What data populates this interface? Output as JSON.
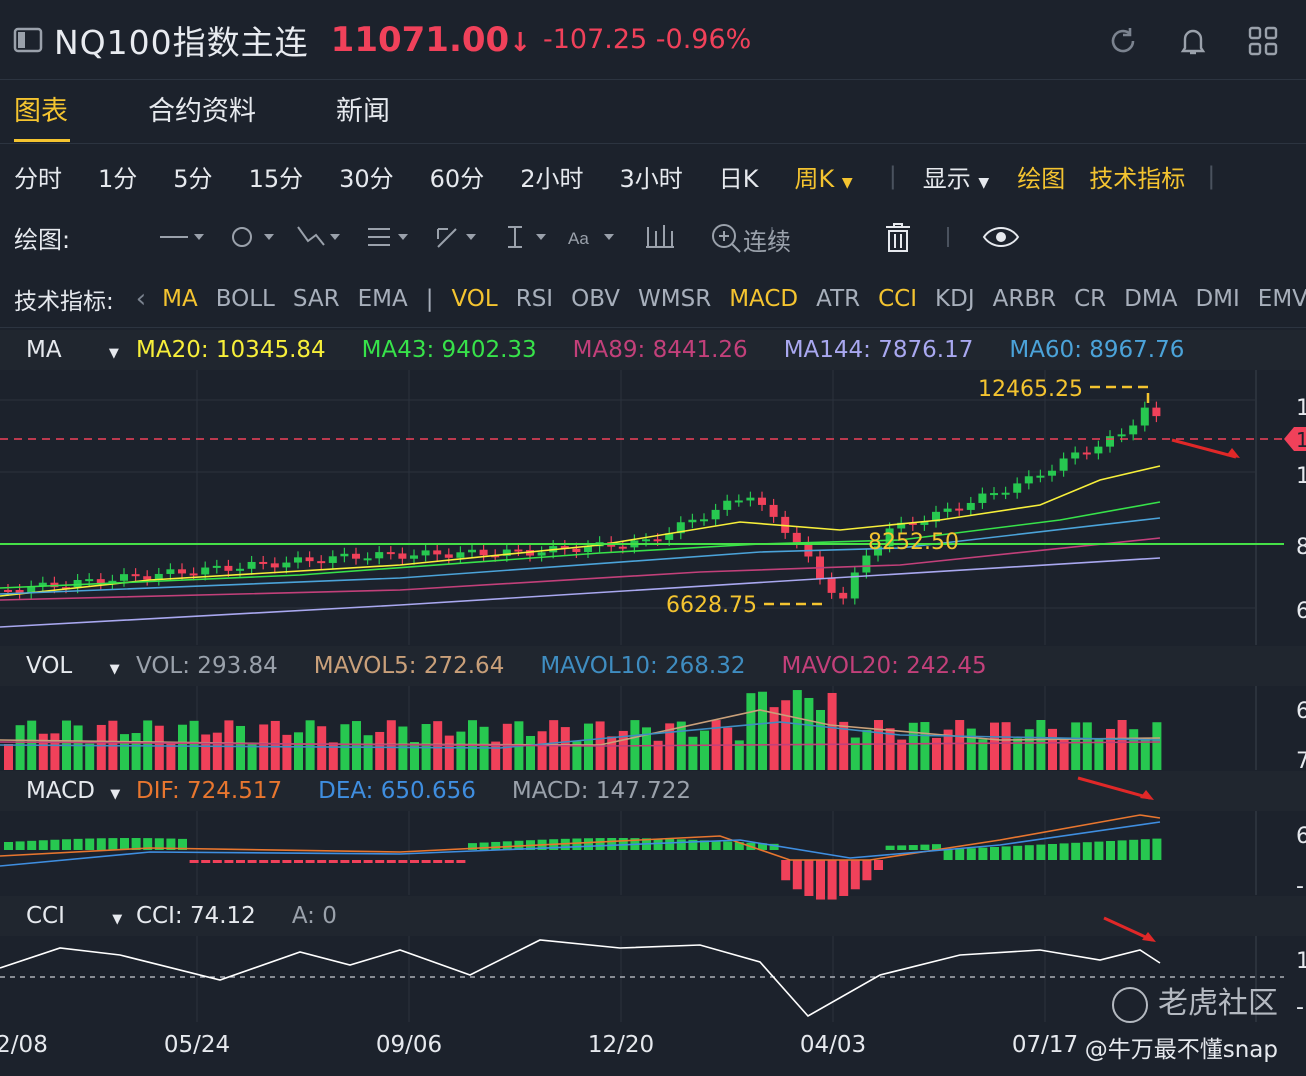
{
  "header": {
    "title": "NQ100指数主连",
    "price": "11071.00",
    "arrow": "↓",
    "change": "-107.25",
    "change_pct": "-0.96%"
  },
  "tabs": [
    "图表",
    "合约资料",
    "新闻"
  ],
  "periods": [
    "分时",
    "1分",
    "5分",
    "15分",
    "30分",
    "60分",
    "2小时",
    "3小时",
    "日K",
    "周K"
  ],
  "period_active": "周K",
  "toolbar": {
    "display": "显示",
    "draw": "绘图",
    "indicators": "技术指标"
  },
  "draw_bar": {
    "label": "绘图:",
    "continuous": "连续"
  },
  "indicator_bar": {
    "label": "技术指标:",
    "items": [
      "MA",
      "BOLL",
      "SAR",
      "EMA",
      "VOL",
      "RSI",
      "OBV",
      "WMSR",
      "MACD",
      "ATR",
      "CCI",
      "KDJ",
      "ARBR",
      "CR",
      "DMA",
      "DMI",
      "EMV"
    ],
    "active": [
      "MA",
      "VOL",
      "MACD",
      "CCI"
    ]
  },
  "ma_legend": {
    "name": "MA",
    "items": [
      {
        "label": "MA20: 10345.84",
        "color": "#f7ef3a"
      },
      {
        "label": "MA43: 9402.33",
        "color": "#37e24a"
      },
      {
        "label": "MA89: 8441.26",
        "color": "#c2407a"
      },
      {
        "label": "MA144: 7876.17",
        "color": "#a9a8f0"
      },
      {
        "label": "MA60: 8967.76",
        "color": "#4ba3d9"
      }
    ]
  },
  "vol_legend": {
    "name": "VOL",
    "items": [
      {
        "label": "VOL: 293.84",
        "color": "#9aa1ab"
      },
      {
        "label": "MAVOL5: 272.64",
        "color": "#c9a07a"
      },
      {
        "label": "MAVOL10: 268.32",
        "color": "#3f8dc1"
      },
      {
        "label": "MAVOL20: 242.45",
        "color": "#c2407a"
      }
    ]
  },
  "macd_legend": {
    "name": "MACD",
    "items": [
      {
        "label": "DIF: 724.517",
        "color": "#e8762f"
      },
      {
        "label": "DEA: 650.656",
        "color": "#3f8ee0"
      },
      {
        "label": "MACD: 147.722",
        "color": "#9aa1ab"
      }
    ]
  },
  "cci_legend": {
    "name": "CCI",
    "items": [
      {
        "label": "CCI: 74.12",
        "color": "#e6e9ee"
      },
      {
        "label": "A: 0",
        "color": "#9aa1ab"
      }
    ]
  },
  "chart_data": {
    "type": "candlestick",
    "x_ticks": [
      "2/08",
      "05/24",
      "09/06",
      "12/20",
      "04/03",
      "07/17"
    ],
    "annotations": [
      {
        "label": "12465.25",
        "kind": "high"
      },
      {
        "label": "6628.75",
        "kind": "low"
      },
      {
        "label": "8252.50",
        "kind": "level"
      }
    ],
    "right_axis_ticks": [
      "1",
      "1",
      "1",
      "8",
      "6"
    ],
    "vol_axis_ticks": [
      "6",
      "7"
    ],
    "macd_axis_ticks": [
      "6",
      "-"
    ],
    "cci_axis_ticks": [
      "1",
      "-"
    ],
    "colors": {
      "up": "#27c850",
      "down": "#f0415a",
      "level": "#45e047",
      "current": "#f0415a"
    }
  },
  "watermark": {
    "brand": "老虎社区",
    "user": "@牛万最不懂snap"
  }
}
